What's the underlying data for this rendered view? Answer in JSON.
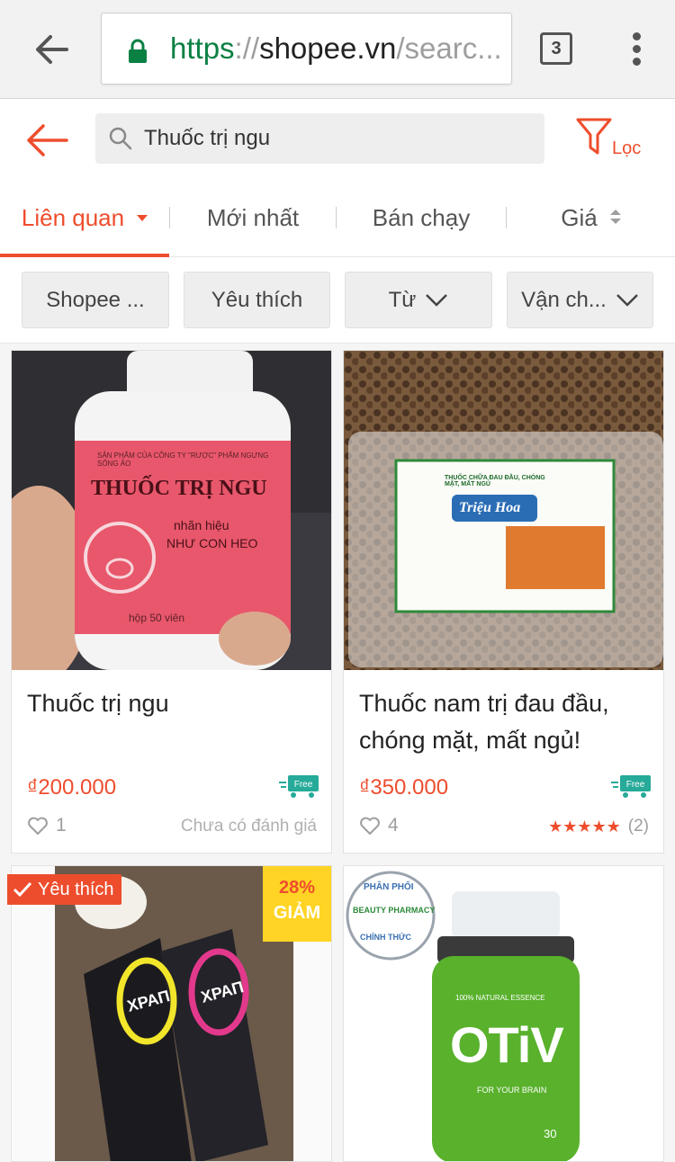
{
  "browser": {
    "url_scheme": "https",
    "url_sep": "://",
    "url_host": "shopee.vn",
    "url_path": "/searc...",
    "tab_count": "3"
  },
  "header": {
    "search_query": "Thuốc trị ngu",
    "filter_label": "Lọc"
  },
  "sort_tabs": [
    {
      "label": "Liên quan"
    },
    {
      "label": "Mới nhất"
    },
    {
      "label": "Bán chạy"
    },
    {
      "label": "Giá"
    }
  ],
  "chips": [
    {
      "label": "Shopee ..."
    },
    {
      "label": "Yêu thích"
    },
    {
      "label": "Từ"
    },
    {
      "label": "Vận ch..."
    }
  ],
  "products": [
    {
      "name": "Thuốc trị ngu",
      "price": "₫200.000",
      "likes": "1",
      "rating_text": "Chưa có đánh giá",
      "img_text": {
        "company": "SẢN PHẨM CỦA CÔNG TY \"RƯỢC\" PHẨM NGƯNG SỐNG ẢO",
        "title": "THUỐC TRỊ NGU",
        "brand1": "nhãn hiệu",
        "brand2": "NHƯ CON HEO",
        "count": "hộp 50 viên"
      }
    },
    {
      "name": "Thuốc nam trị đau đầu, chóng mặt, mất ngủ!",
      "price": "₫350.000",
      "likes": "4",
      "stars": "★★★★★",
      "rating_count": "(2)",
      "img_text": {
        "label_title": "THUỐC CHỮA ĐAU ĐẦU, CHÓNG MẶT, MẤT NGỦ",
        "brand": "Triệu Hoa"
      }
    },
    {
      "badge_fav": "Yêu thích",
      "discount_pct": "28%",
      "discount_word": "GIẢM",
      "img_text": {
        "box1": "ХРАП",
        "box2": "ХРАП"
      }
    },
    {
      "img_text": {
        "seal_top": "PHÂN PHỐI",
        "seal_mid": "BEAUTY PHARMACY",
        "seal_bottom": "CHÍNH THỨC",
        "natural": "100% NATURAL ESSENCE",
        "brand": "OTiV",
        "sub": "FOR YOUR BRAIN",
        "caps": "30"
      }
    }
  ],
  "free_label": "Free",
  "colors": {
    "accent": "#ee4d2d",
    "lock_green": "#0b8043",
    "pink_label": "#e8576b",
    "otiv_green": "#59b12c",
    "discount_yellow": "#ffd424"
  }
}
